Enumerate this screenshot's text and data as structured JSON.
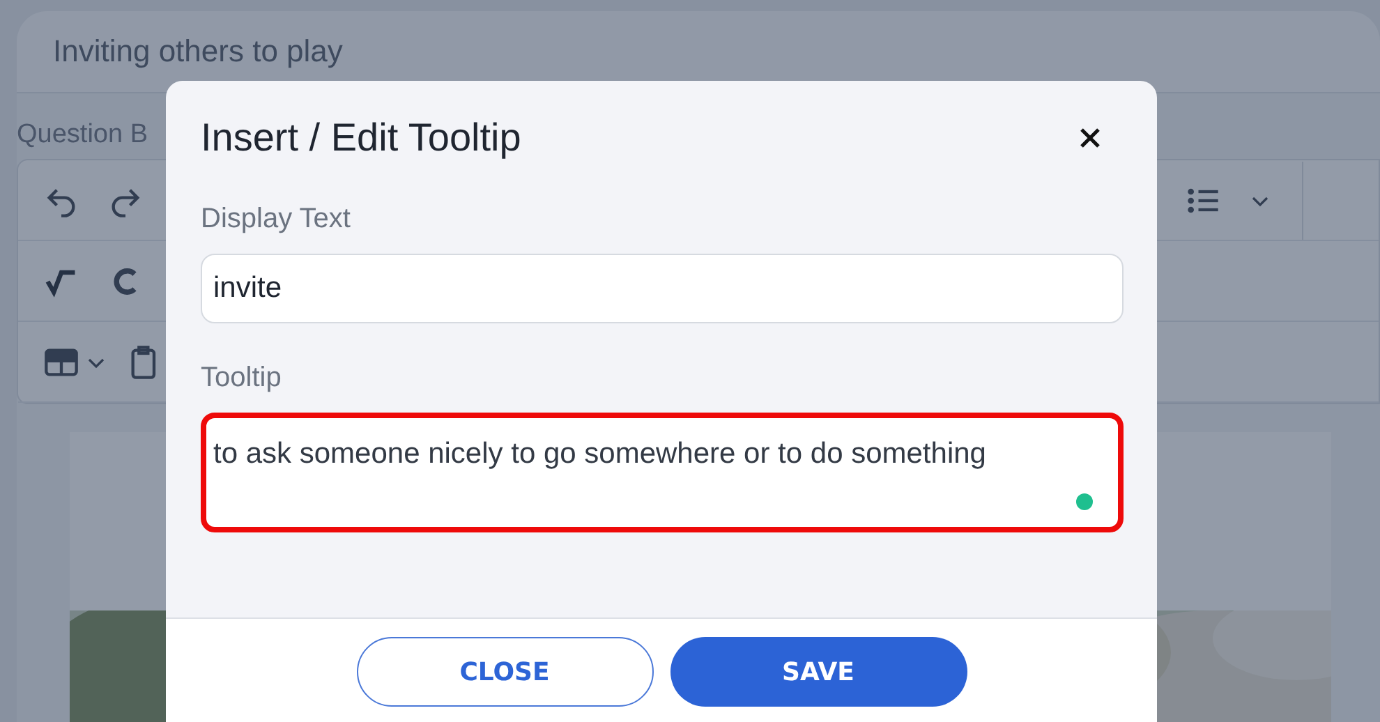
{
  "page": {
    "title": "Inviting others to play",
    "section_label": "Question B"
  },
  "dialog": {
    "title": "Insert / Edit Tooltip",
    "fields": [
      {
        "label": "Display Text",
        "value": "invite",
        "kind": "input",
        "highlighted": false
      },
      {
        "label": "Tooltip",
        "value": "to ask someone nicely to go somewhere or to do something",
        "kind": "textarea",
        "highlighted": true
      }
    ],
    "buttons": [
      {
        "label": "CLOSE",
        "kind": "secondary"
      },
      {
        "label": "SAVE",
        "kind": "primary"
      }
    ]
  }
}
